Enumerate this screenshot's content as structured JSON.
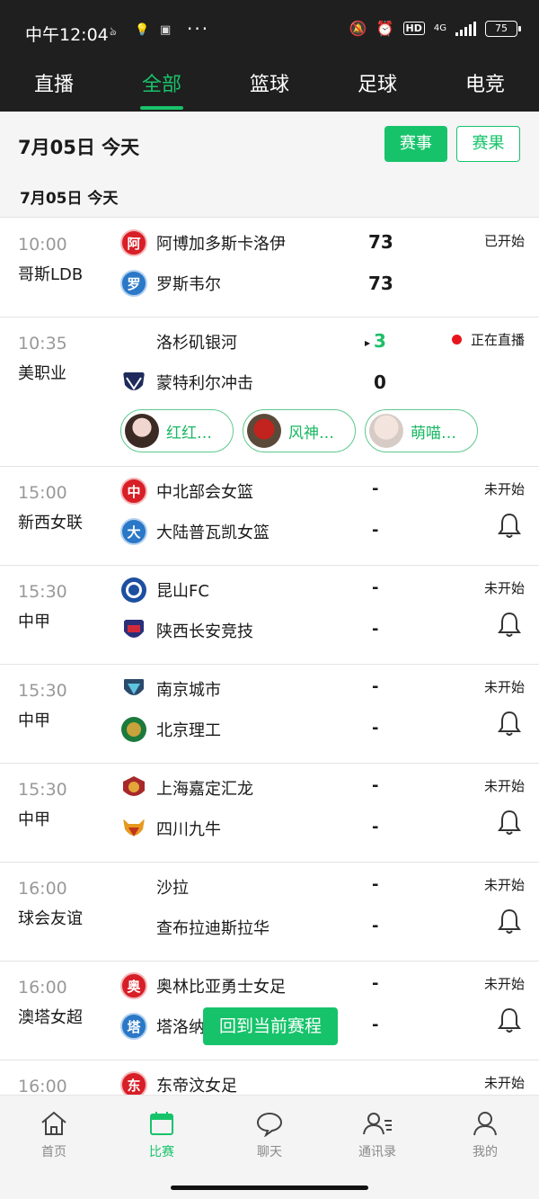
{
  "status_bar": {
    "time": "中午12:04",
    "more": "···",
    "hd": "HD",
    "network": "4G",
    "battery": "75"
  },
  "tabs": [
    {
      "label": "直播"
    },
    {
      "label": "全部",
      "active": true
    },
    {
      "label": "篮球"
    },
    {
      "label": "足球"
    },
    {
      "label": "电竞"
    }
  ],
  "date_header": {
    "title": "7月05日 今天",
    "events_button": "赛事",
    "results_button": "赛果",
    "sub_title": "7月05日 今天"
  },
  "matches": [
    {
      "time": "10:00",
      "league": "哥斯LDB",
      "home": "阿博加多斯卡洛伊",
      "home_icon": "阿",
      "away": "罗斯韦尔",
      "away_icon": "罗",
      "home_score": "73",
      "away_score": "73",
      "status": "已开始"
    },
    {
      "time": "10:35",
      "league": "美职业",
      "home": "洛杉矶银河",
      "away": "蒙特利尔冲击",
      "home_score": "3",
      "away_score": "0",
      "status": "正在直播",
      "anchors": [
        {
          "name": "红红…"
        },
        {
          "name": "风神…"
        },
        {
          "name": "萌喵…"
        }
      ]
    },
    {
      "time": "15:00",
      "league": "新西女联",
      "home": "中北部会女篮",
      "home_icon": "中",
      "away": "大陆普瓦凯女篮",
      "away_icon": "大",
      "home_score": "-",
      "away_score": "-",
      "status": "未开始"
    },
    {
      "time": "15:30",
      "league": "中甲",
      "home": "昆山FC",
      "away": "陕西长安竞技",
      "home_score": "-",
      "away_score": "-",
      "status": "未开始"
    },
    {
      "time": "15:30",
      "league": "中甲",
      "home": "南京城市",
      "away": "北京理工",
      "home_score": "-",
      "away_score": "-",
      "status": "未开始"
    },
    {
      "time": "15:30",
      "league": "中甲",
      "home": "上海嘉定汇龙",
      "away": "四川九牛",
      "home_score": "-",
      "away_score": "-",
      "status": "未开始"
    },
    {
      "time": "16:00",
      "league": "球会友谊",
      "home": "沙拉",
      "away": "查布拉迪斯拉华",
      "home_score": "-",
      "away_score": "-",
      "status": "未开始"
    },
    {
      "time": "16:00",
      "league": "澳塔女超",
      "home": "奥林比亚勇士女足",
      "home_icon": "奥",
      "away": "塔洛纳",
      "away_icon": "塔",
      "home_score": "-",
      "away_score": "-",
      "status": "未开始"
    },
    {
      "time": "16:00",
      "home": "东帝汶女足",
      "home_icon": "东",
      "status": "未开始"
    }
  ],
  "floating_button": "回到当前赛程",
  "bottom_nav": [
    {
      "label": "首页",
      "icon": "home-icon"
    },
    {
      "label": "比赛",
      "icon": "calendar-icon",
      "active": true
    },
    {
      "label": "聊天",
      "icon": "chat-bubble-icon"
    },
    {
      "label": "通讯录",
      "icon": "contacts-icon"
    },
    {
      "label": "我的",
      "icon": "person-icon"
    }
  ],
  "colors": {
    "accent": "#17c36a",
    "live": "#e8161c",
    "topbar": "#1f1f1f"
  }
}
